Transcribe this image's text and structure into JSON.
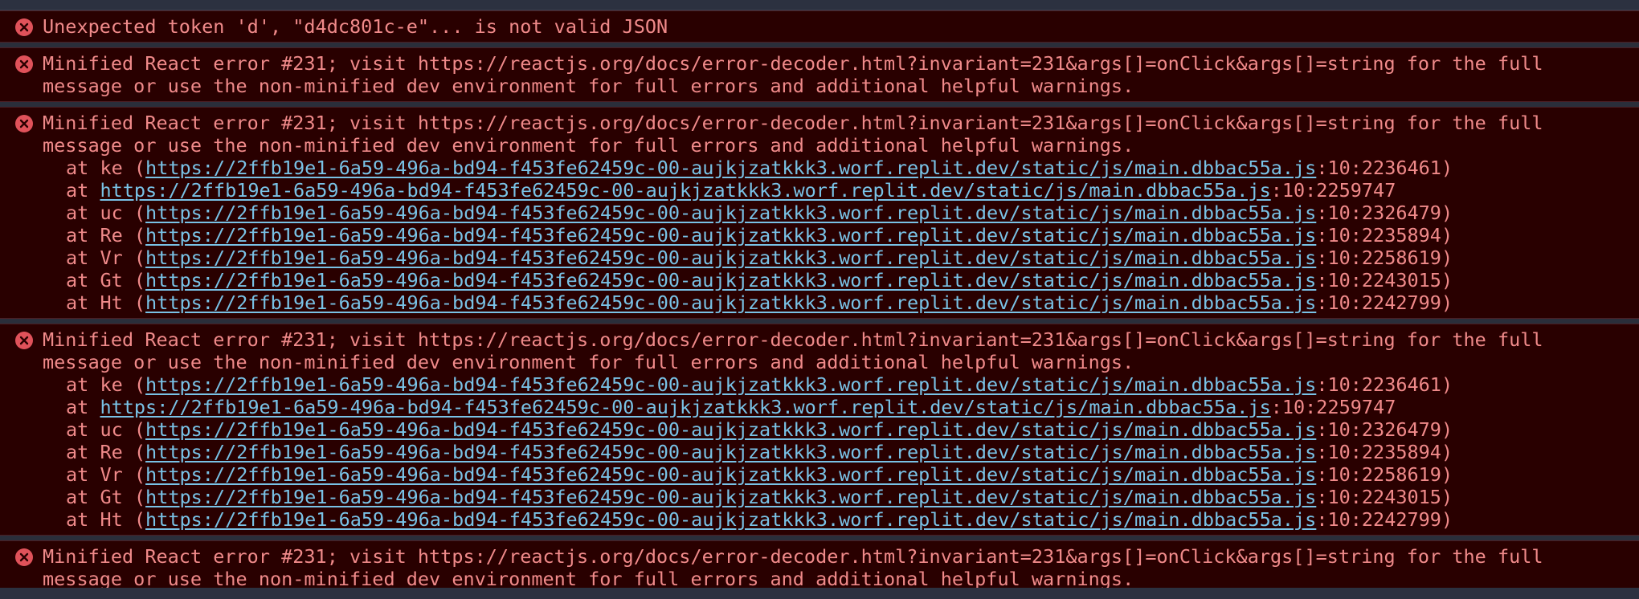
{
  "entries": [
    {
      "lines": [
        "Unexpected token 'd', \"d4dc801c-e\"... is not valid JSON"
      ],
      "frames": []
    },
    {
      "lines": [
        "Minified React error #231; visit https://reactjs.org/docs/error-decoder.html?invariant=231&args[]=onClick&args[]=string for the full",
        "message or use the non-minified dev environment for full errors and additional helpful warnings."
      ],
      "frames": []
    },
    {
      "lines": [
        "Minified React error #231; visit https://reactjs.org/docs/error-decoder.html?invariant=231&args[]=onClick&args[]=string for the full",
        "message or use the non-minified dev environment for full errors and additional helpful warnings."
      ],
      "frames": [
        {
          "prefix": "at ke (",
          "url": "https://2ffb19e1-6a59-496a-bd94-f453fe62459c-00-aujkjzatkkk3.worf.replit.dev/static/js/main.dbbac55a.js",
          "loc": ":10:2236461)"
        },
        {
          "prefix": "at ",
          "url": "https://2ffb19e1-6a59-496a-bd94-f453fe62459c-00-aujkjzatkkk3.worf.replit.dev/static/js/main.dbbac55a.js",
          "loc": ":10:2259747"
        },
        {
          "prefix": "at uc (",
          "url": "https://2ffb19e1-6a59-496a-bd94-f453fe62459c-00-aujkjzatkkk3.worf.replit.dev/static/js/main.dbbac55a.js",
          "loc": ":10:2326479)"
        },
        {
          "prefix": "at Re (",
          "url": "https://2ffb19e1-6a59-496a-bd94-f453fe62459c-00-aujkjzatkkk3.worf.replit.dev/static/js/main.dbbac55a.js",
          "loc": ":10:2235894)"
        },
        {
          "prefix": "at Vr (",
          "url": "https://2ffb19e1-6a59-496a-bd94-f453fe62459c-00-aujkjzatkkk3.worf.replit.dev/static/js/main.dbbac55a.js",
          "loc": ":10:2258619)"
        },
        {
          "prefix": "at Gt (",
          "url": "https://2ffb19e1-6a59-496a-bd94-f453fe62459c-00-aujkjzatkkk3.worf.replit.dev/static/js/main.dbbac55a.js",
          "loc": ":10:2243015)"
        },
        {
          "prefix": "at Ht (",
          "url": "https://2ffb19e1-6a59-496a-bd94-f453fe62459c-00-aujkjzatkkk3.worf.replit.dev/static/js/main.dbbac55a.js",
          "loc": ":10:2242799)"
        }
      ]
    },
    {
      "lines": [
        "Minified React error #231; visit https://reactjs.org/docs/error-decoder.html?invariant=231&args[]=onClick&args[]=string for the full",
        "message or use the non-minified dev environment for full errors and additional helpful warnings."
      ],
      "frames": [
        {
          "prefix": "at ke (",
          "url": "https://2ffb19e1-6a59-496a-bd94-f453fe62459c-00-aujkjzatkkk3.worf.replit.dev/static/js/main.dbbac55a.js",
          "loc": ":10:2236461)"
        },
        {
          "prefix": "at ",
          "url": "https://2ffb19e1-6a59-496a-bd94-f453fe62459c-00-aujkjzatkkk3.worf.replit.dev/static/js/main.dbbac55a.js",
          "loc": ":10:2259747"
        },
        {
          "prefix": "at uc (",
          "url": "https://2ffb19e1-6a59-496a-bd94-f453fe62459c-00-aujkjzatkkk3.worf.replit.dev/static/js/main.dbbac55a.js",
          "loc": ":10:2326479)"
        },
        {
          "prefix": "at Re (",
          "url": "https://2ffb19e1-6a59-496a-bd94-f453fe62459c-00-aujkjzatkkk3.worf.replit.dev/static/js/main.dbbac55a.js",
          "loc": ":10:2235894)"
        },
        {
          "prefix": "at Vr (",
          "url": "https://2ffb19e1-6a59-496a-bd94-f453fe62459c-00-aujkjzatkkk3.worf.replit.dev/static/js/main.dbbac55a.js",
          "loc": ":10:2258619)"
        },
        {
          "prefix": "at Gt (",
          "url": "https://2ffb19e1-6a59-496a-bd94-f453fe62459c-00-aujkjzatkkk3.worf.replit.dev/static/js/main.dbbac55a.js",
          "loc": ":10:2243015)"
        },
        {
          "prefix": "at Ht (",
          "url": "https://2ffb19e1-6a59-496a-bd94-f453fe62459c-00-aujkjzatkkk3.worf.replit.dev/static/js/main.dbbac55a.js",
          "loc": ":10:2242799)"
        }
      ]
    },
    {
      "lines": [
        "Minified React error #231; visit https://reactjs.org/docs/error-decoder.html?invariant=231&args[]=onClick&args[]=string for the full",
        "message or use the non-minified dev environment for full errors and additional helpful warnings."
      ],
      "frames": []
    }
  ]
}
